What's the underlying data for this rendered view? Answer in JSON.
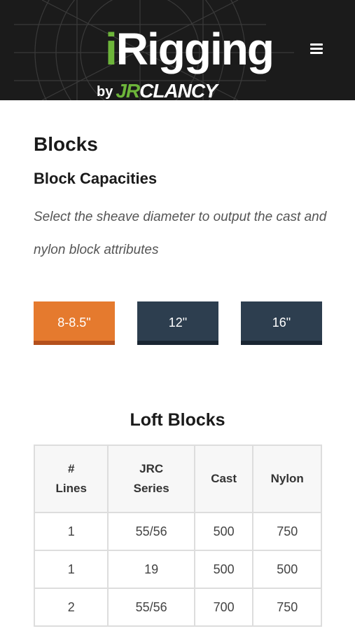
{
  "header": {
    "logo": {
      "prefix": "i",
      "name": "Rigging",
      "by": "by",
      "brand_jr": "JR",
      "brand_rest": "CLANCY"
    },
    "menu_icon": "hamburger-menu-icon"
  },
  "page": {
    "title": "Blocks",
    "subtitle": "Block Capacities",
    "instructions": "Select the sheave diameter to output the cast and nylon block attributes"
  },
  "sheave_buttons": [
    {
      "label": "8-8.5\"",
      "active": true
    },
    {
      "label": "12\"",
      "active": false
    },
    {
      "label": "16\"",
      "active": false
    }
  ],
  "colors": {
    "header_bg": "#1b1b1b",
    "accent_green": "#6db53a",
    "active_button": "#e57a2e",
    "inactive_button": "#2d3e4f"
  },
  "table": {
    "title": "Loft Blocks",
    "headers": [
      {
        "line1": "#",
        "line2": "Lines"
      },
      {
        "line1": "JRC",
        "line2": "Series"
      },
      {
        "line1": "Cast",
        "line2": ""
      },
      {
        "line1": "Nylon",
        "line2": ""
      }
    ],
    "rows": [
      [
        "1",
        "55/56",
        "500",
        "750"
      ],
      [
        "1",
        "19",
        "500",
        "500"
      ],
      [
        "2",
        "55/56",
        "700",
        "750"
      ]
    ]
  }
}
